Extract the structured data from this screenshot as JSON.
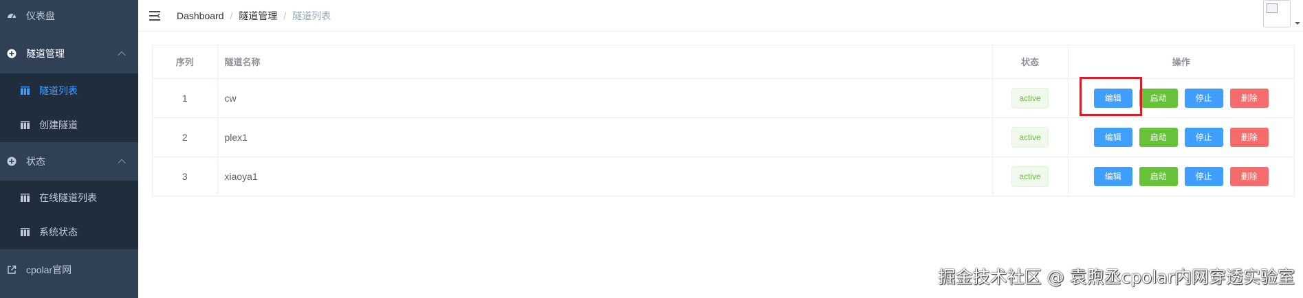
{
  "sidebar": {
    "dashboard": "仪表盘",
    "tunnel_mgmt": "隧道管理",
    "tunnel_list": "隧道列表",
    "create_tunnel": "创建隧道",
    "status": "状态",
    "online_tunnels": "在线隧道列表",
    "system_status": "系统状态",
    "cpolar_site": "cpolar官网"
  },
  "breadcrumb": [
    "Dashboard",
    "隧道管理",
    "隧道列表"
  ],
  "table": {
    "headers": {
      "index": "序列",
      "name": "隧道名称",
      "status": "状态",
      "ops": "操作"
    },
    "rows": [
      {
        "index": "1",
        "name": "cw",
        "status": "active"
      },
      {
        "index": "2",
        "name": "plex1",
        "status": "active"
      },
      {
        "index": "3",
        "name": "xiaoya1",
        "status": "active"
      }
    ],
    "actions": {
      "edit": "编辑",
      "start": "启动",
      "stop": "停止",
      "delete": "删除"
    }
  },
  "colors": {
    "sidebar_bg": "#304156",
    "active": "#409eff",
    "success": "#67c23a",
    "danger": "#f56c6c",
    "highlight": "#d81e24"
  },
  "watermark": "掘金技术社区 @ 袁煦丞cpolar内网穿透实验室"
}
